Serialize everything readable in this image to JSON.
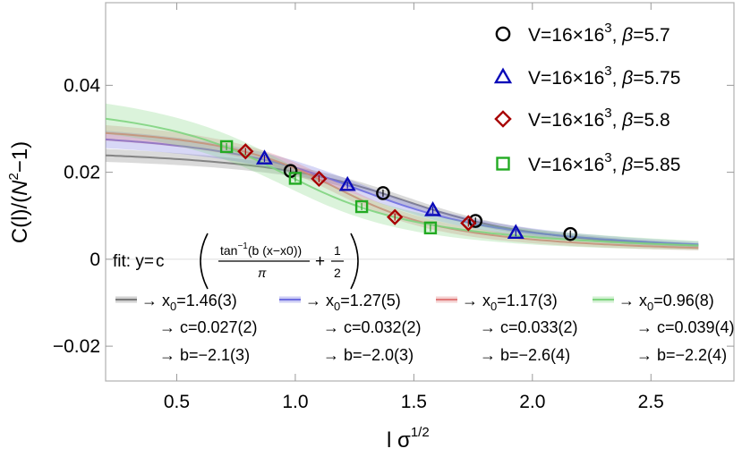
{
  "chart_data": {
    "type": "scatter",
    "xlabel": "l σ",
    "xlabel_sup": "1/2",
    "ylabel_parts": [
      "C(l)/(",
      "N",
      "2",
      "−1)"
    ],
    "xlim": [
      0.2,
      2.85
    ],
    "ylim": [
      -0.028,
      0.059
    ],
    "x_ticks": [
      {
        "value": 0.5,
        "label": "0.5"
      },
      {
        "value": 1.0,
        "label": "1.0"
      },
      {
        "value": 1.5,
        "label": "1.5"
      },
      {
        "value": 2.0,
        "label": "2.0"
      },
      {
        "value": 2.5,
        "label": "2.5"
      }
    ],
    "y_ticks": [
      {
        "value": 0.04,
        "label": "0.04"
      },
      {
        "value": 0.02,
        "label": "0.02"
      },
      {
        "value": 0.0,
        "label": "0"
      },
      {
        "value": -0.02,
        "label": "−0.02"
      }
    ],
    "fit_range": [
      0.2,
      2.7
    ],
    "legend_position": "top-right",
    "series": [
      {
        "name_prefix": "V=16×16",
        "name_sup": "3",
        "name_beta": "β",
        "name_suffix": "=5.7",
        "marker": "circle",
        "color": "#000000",
        "fit_color": "#7a7a7a",
        "x": [
          0.98,
          1.37,
          1.76,
          2.16
        ],
        "y": [
          0.0203,
          0.0152,
          0.0088,
          0.0058
        ],
        "fit": {
          "x0": 1.46,
          "c": 0.027,
          "b": -2.1,
          "x0_label": "1.46(3)",
          "c_label": "0.027(2)",
          "b_label": "−2.1(3)"
        }
      },
      {
        "name_prefix": "V=16×16",
        "name_sup": "3",
        "name_beta": "β",
        "name_suffix": "=5.75",
        "marker": "triangle",
        "color": "#0a0ab8",
        "fit_color": "#6f6fe0",
        "x": [
          0.87,
          1.22,
          1.58,
          1.93
        ],
        "y": [
          0.0232,
          0.0171,
          0.0113,
          0.0061
        ],
        "fit": {
          "x0": 1.27,
          "c": 0.032,
          "b": -2.0,
          "x0_label": "1.27(5)",
          "c_label": "0.032(2)",
          "b_label": "−2.0(3)"
        }
      },
      {
        "name_prefix": "V=16×16",
        "name_sup": "3",
        "name_beta": "β",
        "name_suffix": "=5.8",
        "marker": "diamond",
        "color": "#a80000",
        "fit_color": "#e07a7a",
        "x": [
          0.79,
          1.1,
          1.42,
          1.73
        ],
        "y": [
          0.0248,
          0.0185,
          0.0097,
          0.0083
        ],
        "fit": {
          "x0": 1.17,
          "c": 0.033,
          "b": -2.6,
          "x0_label": "1.17(3)",
          "c_label": "0.033(2)",
          "b_label": "−2.6(4)"
        }
      },
      {
        "name_prefix": "V=16×16",
        "name_sup": "3",
        "name_beta": "β",
        "name_suffix": "=5.85",
        "marker": "square",
        "color": "#22aa22",
        "fit_color": "#7fd47f",
        "x": [
          0.71,
          1.0,
          1.28,
          1.57
        ],
        "y": [
          0.0259,
          0.0186,
          0.0121,
          0.0072
        ],
        "fit": {
          "x0": 0.96,
          "c": 0.039,
          "b": -2.2,
          "x0_label": "0.96(8)",
          "c_label": "0.039(4)",
          "b_label": "−2.2(4)"
        }
      }
    ],
    "fit_formula": {
      "prefix": "fit: y",
      "eq": "=",
      "c": "c",
      "numerator": "tan",
      "numerator_sup": "−1",
      "numerator_rest": "(b (x−x0))",
      "denominator": "π",
      "plus": "+",
      "half_num": "1",
      "half_den": "2"
    },
    "fit_labels": {
      "arrow": "→",
      "x0_name": "x",
      "x0_sub": "0",
      "c_name": "c",
      "b_name": "b"
    }
  }
}
